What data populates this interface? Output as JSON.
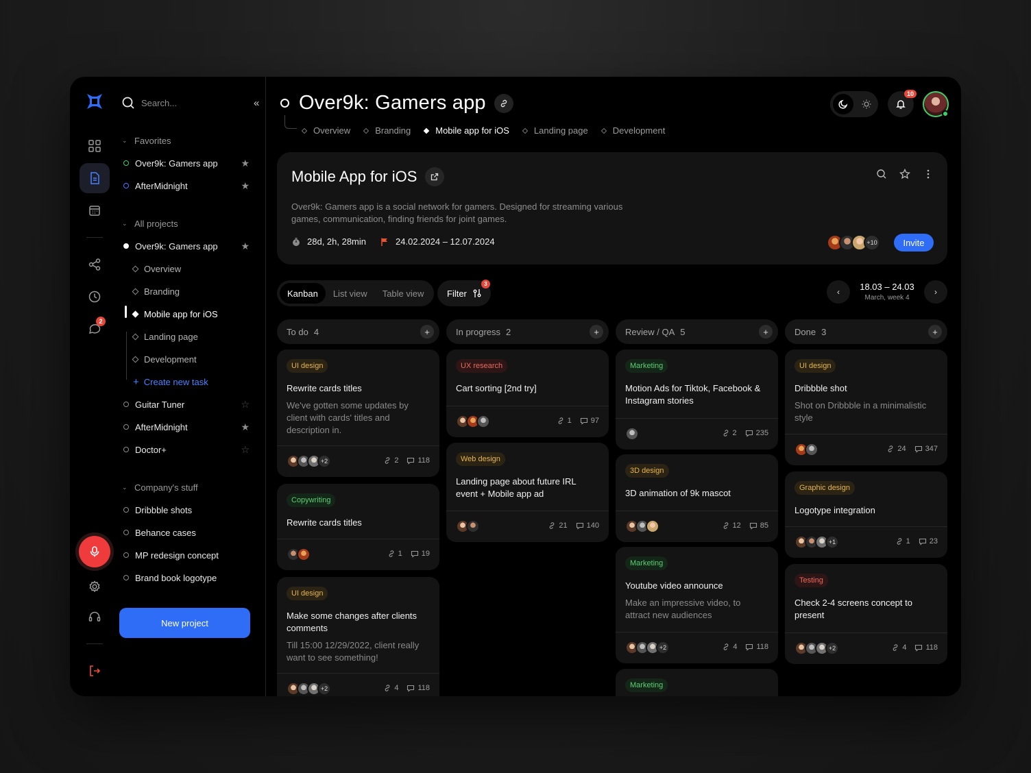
{
  "search": {
    "placeholder": "Search..."
  },
  "rail": {
    "chat_badge": "2"
  },
  "sidebar": {
    "favorites_label": "Favorites",
    "favorites": [
      {
        "label": "Over9k: Gamers app"
      },
      {
        "label": "AfterMidnight"
      }
    ],
    "all_projects_label": "All projects",
    "projects": [
      {
        "label": "Over9k: Gamers app"
      },
      {
        "label": "Guitar Tuner"
      },
      {
        "label": "AfterMidnight"
      },
      {
        "label": "Doctor+"
      }
    ],
    "subitems": [
      {
        "label": "Overview"
      },
      {
        "label": "Branding"
      },
      {
        "label": "Mobile app for iOS"
      },
      {
        "label": "Landing page"
      },
      {
        "label": "Development"
      }
    ],
    "create_task": "Create new task",
    "company_label": "Company's stuff",
    "company": [
      {
        "label": "Dribbble shots"
      },
      {
        "label": "Behance cases"
      },
      {
        "label": "MP redesign concept"
      },
      {
        "label": "Brand book logotype"
      }
    ],
    "new_project": "New project"
  },
  "header": {
    "title": "Over9k: Gamers app",
    "tabs": [
      {
        "label": "Overview"
      },
      {
        "label": "Branding"
      },
      {
        "label": "Mobile app for iOS"
      },
      {
        "label": "Landing page"
      },
      {
        "label": "Development"
      }
    ],
    "notifications": "10"
  },
  "project": {
    "title": "Mobile App for iOS",
    "description": "Over9k: Gamers app is a social network for gamers. Designed for streaming various games, communication, finding friends for joint games.",
    "time_spent": "28d, 2h, 28min",
    "date_range": "24.02.2024 – 12.07.2024",
    "team_more": "+10",
    "invite": "Invite"
  },
  "views": {
    "kanban": "Kanban",
    "list": "List view",
    "table": "Table view",
    "filter": "Filter",
    "filter_count": "3"
  },
  "week": {
    "range": "18.03 – 24.03",
    "label": "March, week 4"
  },
  "board": {
    "columns": [
      {
        "title": "To do",
        "count": "4",
        "cards": [
          {
            "tag": "UI design",
            "title": "Rewrite cards titles",
            "desc": "We've gotten some updates by client with cards' titles and description in.",
            "more": "+2",
            "links": "2",
            "comments": "118"
          },
          {
            "tag": "Copywriting",
            "title": "Rewrite cards titles",
            "links": "1",
            "comments": "19"
          },
          {
            "tag": "UI design",
            "title": "Make some changes after clients comments",
            "desc": "Till 15:00 12/29/2022, client really want to see something!",
            "more": "+2",
            "links": "4",
            "comments": "118"
          }
        ]
      },
      {
        "title": "In progress",
        "count": "2",
        "cards": [
          {
            "tag": "UX research",
            "title": "Cart sorting [2nd try]",
            "links": "1",
            "comments": "97"
          },
          {
            "tag": "Web design",
            "title": "Landing page about future IRL event + Mobile app ad",
            "links": "21",
            "comments": "140"
          }
        ]
      },
      {
        "title": "Review / QA",
        "count": "5",
        "cards": [
          {
            "tag": "Marketing",
            "title": "Motion Ads for Tiktok, Facebook & Instagram stories",
            "links": "2",
            "comments": "235"
          },
          {
            "tag": "3D design",
            "title": "3D animation of 9k mascot",
            "links": "12",
            "comments": "85"
          },
          {
            "tag": "Marketing",
            "title": "Youtube video announce",
            "desc": "Make an impressive video, to attract new audiences",
            "more": "+2",
            "links": "4",
            "comments": "118"
          },
          {
            "tag": "Marketing"
          }
        ]
      },
      {
        "title": "Done",
        "count": "3",
        "cards": [
          {
            "tag": "UI design",
            "title": "Dribbble shot",
            "desc": "Shot on Dribbble in a minimalistic style",
            "links": "24",
            "comments": "347"
          },
          {
            "tag": "Graphic design",
            "title": "Logotype integration",
            "more": "+1",
            "links": "1",
            "comments": "23"
          },
          {
            "tag": "Testing",
            "title": "Check 2-4 screens concept to present",
            "more": "+2",
            "links": "4",
            "comments": "118"
          }
        ]
      }
    ]
  },
  "colors": {
    "accent": "#2f6df6",
    "danger": "#e5483a",
    "success": "#3ecf6a",
    "background": "#000000"
  }
}
